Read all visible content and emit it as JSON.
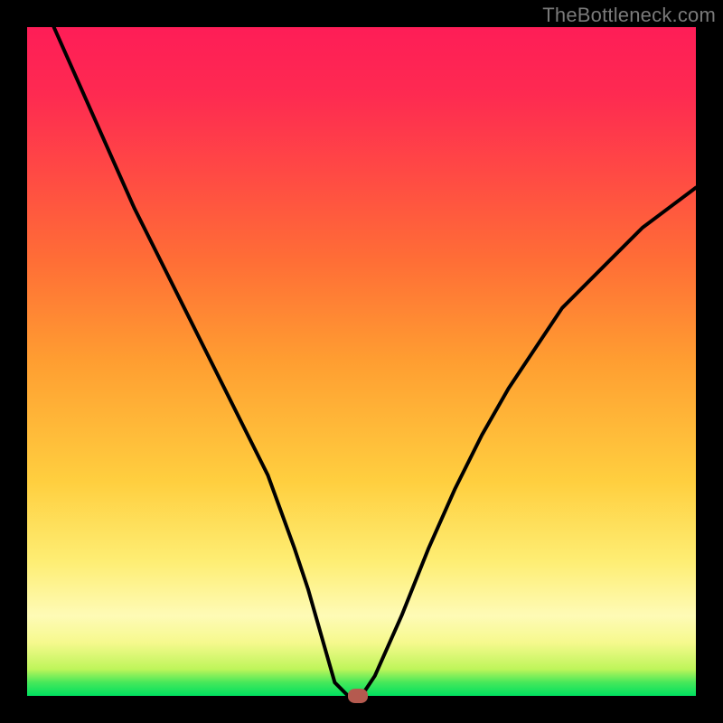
{
  "watermark": "TheBottleneck.com",
  "chart_data": {
    "type": "line",
    "title": "",
    "xlabel": "",
    "ylabel": "",
    "xlim": [
      0,
      100
    ],
    "ylim": [
      0,
      100
    ],
    "grid": false,
    "legend": null,
    "background_gradient": {
      "bottom_color": "#00e060",
      "top_color": "#fe1d57",
      "description": "green at bottom through yellow/orange to red at top"
    },
    "series": [
      {
        "name": "curve",
        "color": "#000000",
        "x": [
          4,
          8,
          12,
          16,
          20,
          24,
          28,
          32,
          36,
          40,
          42,
          44,
          46,
          48,
          50,
          52,
          56,
          60,
          64,
          68,
          72,
          76,
          80,
          84,
          88,
          92,
          96,
          100
        ],
        "y": [
          100,
          91,
          82,
          73,
          65,
          57,
          49,
          41,
          33,
          22,
          16,
          9,
          2,
          0,
          0,
          3,
          12,
          22,
          31,
          39,
          46,
          52,
          58,
          62,
          66,
          70,
          73,
          76
        ]
      }
    ],
    "marker": {
      "x": 49.5,
      "y": 0,
      "color": "#b55a4f",
      "shape": "rounded-rect"
    }
  }
}
